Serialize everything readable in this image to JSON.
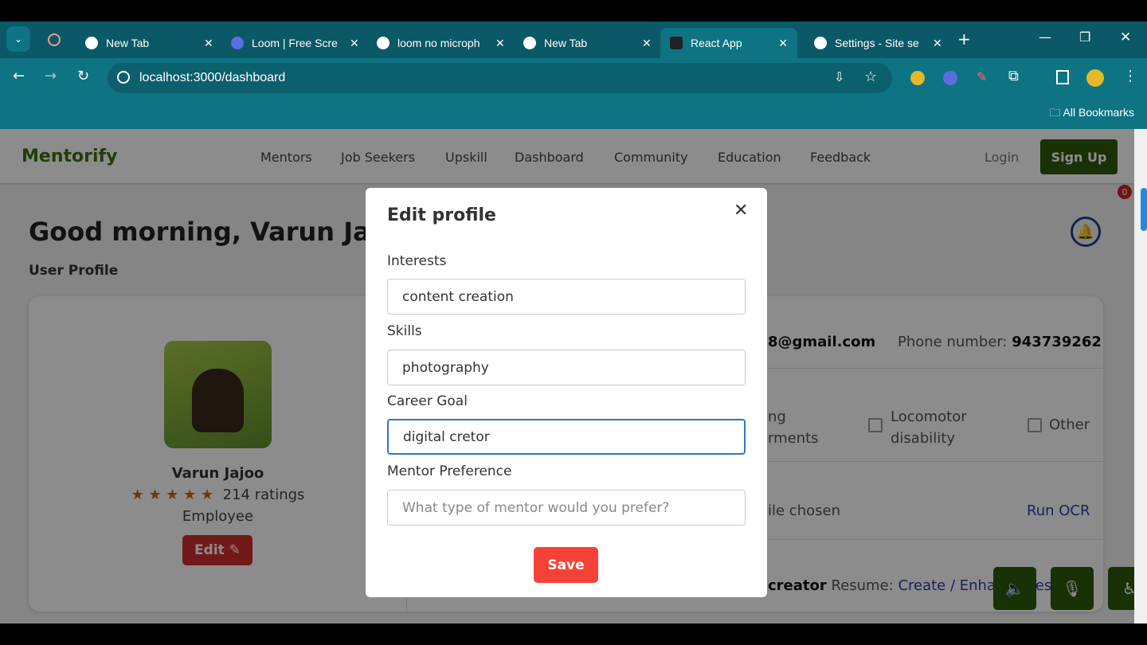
{
  "browser": {
    "tabs": [
      {
        "label": "New Tab"
      },
      {
        "label": "Loom | Free Scre"
      },
      {
        "label": "loom no microph"
      },
      {
        "label": "New Tab"
      },
      {
        "label": "React App"
      },
      {
        "label": "Settings - Site se"
      }
    ],
    "url": "localhost:3000/dashboard",
    "bookmarks_label": "All Bookmarks"
  },
  "nav": {
    "brand": "Mentorify",
    "links": [
      "Mentors",
      "Job Seekers",
      "Upskill",
      "Dashboard",
      "Community",
      "Education",
      "Feedback"
    ],
    "login": "Login",
    "signup": "Sign Up"
  },
  "dashboard": {
    "greeting": "Good morning, Varun Jajoo",
    "section": "User Profile",
    "name": "Varun Jajoo",
    "stars": "★ ★ ★ ★ ★",
    "ratings": "214 ratings",
    "role": "Employee",
    "edit": "Edit ✎",
    "email_partial": "8@gmail.com",
    "phone_label": "Phone number: ",
    "phone": "943739262",
    "disab_partial_1": "ng",
    "disab_partial_2": "rments",
    "locomotor": "Locomotor disability",
    "other": "Other",
    "file_partial": "ile chosen",
    "run_ocr": "Run OCR",
    "goal_partial": "creator",
    "resume_label": "Resume: ",
    "resume_link": "Create / Enhance Resu",
    "notification_count": "0"
  },
  "modal": {
    "title": "Edit profile",
    "fields": [
      {
        "label": "Interests",
        "value": "content creation",
        "placeholder": ""
      },
      {
        "label": "Skills",
        "value": "photography",
        "placeholder": ""
      },
      {
        "label": "Career Goal",
        "value": "digital cretor",
        "placeholder": ""
      },
      {
        "label": "Mentor Preference",
        "value": "",
        "placeholder": "What type of mentor would you prefer?"
      }
    ],
    "save": "Save"
  },
  "colors": {
    "brand": "#3f6f14",
    "accent_button": "#2d5a0a",
    "save": "#f44336",
    "edit": "#d32f2f",
    "link": "#1f3f8f"
  }
}
